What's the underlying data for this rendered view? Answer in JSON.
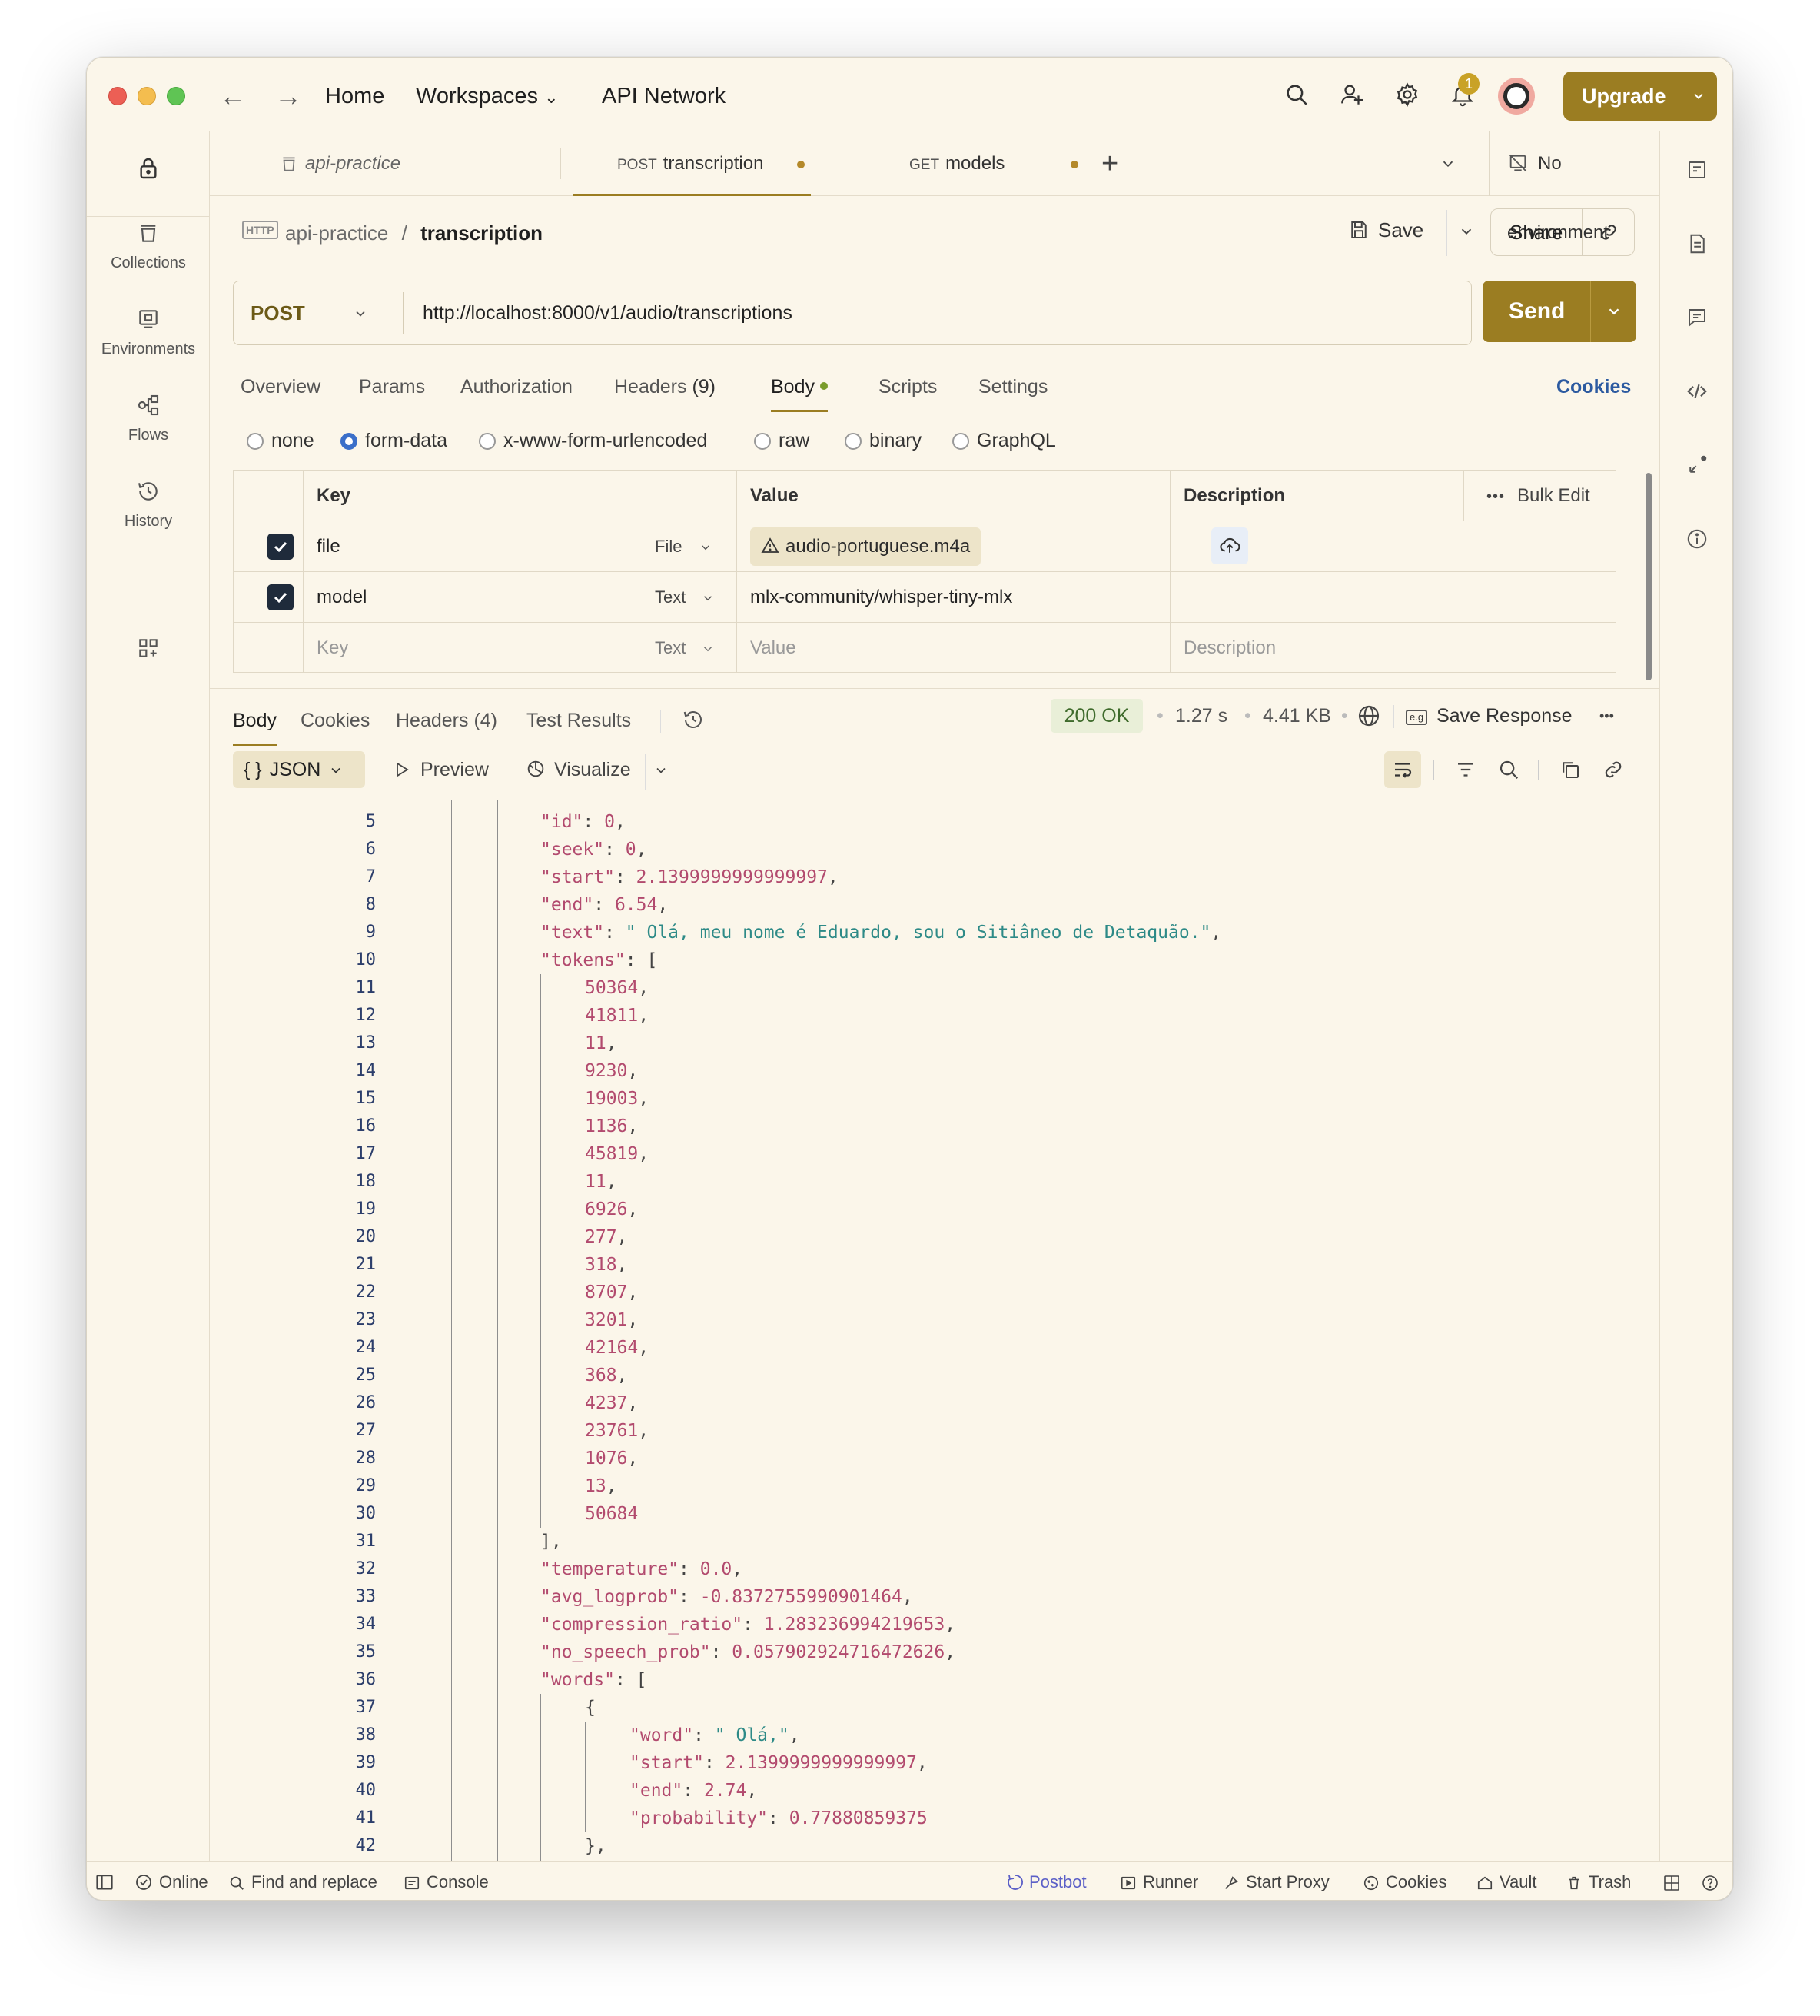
{
  "titlebar": {
    "home": "Home",
    "workspaces": "Workspaces",
    "api_network": "API Network",
    "notification_count": "1",
    "upgrade": "Upgrade"
  },
  "leftbar": {
    "items": [
      {
        "label": "Collections",
        "icon": "collections-icon"
      },
      {
        "label": "Environments",
        "icon": "environments-icon"
      },
      {
        "label": "Flows",
        "icon": "flows-icon"
      },
      {
        "label": "History",
        "icon": "history-icon"
      }
    ]
  },
  "tabs": [
    {
      "method": "",
      "label": "api-practice"
    },
    {
      "method": "POST",
      "label": "transcription"
    },
    {
      "method": "GET",
      "label": "models"
    }
  ],
  "environment": "No environment",
  "breadcrumb": {
    "collection": "api-practice",
    "separator": "/",
    "request": "transcription",
    "http_badge": "HTTP"
  },
  "actions": {
    "save": "Save",
    "share": "Share"
  },
  "request": {
    "method": "POST",
    "url": "http://localhost:8000/v1/audio/transcriptions",
    "send": "Send"
  },
  "request_tabs": [
    "Overview",
    "Params",
    "Authorization",
    "Headers",
    "(9)",
    "Body",
    "Scripts",
    "Settings"
  ],
  "cookies_link": "Cookies",
  "body_types": [
    "none",
    "form-data",
    "x-www-form-urlencoded",
    "raw",
    "binary",
    "GraphQL"
  ],
  "kv_table": {
    "headers": {
      "key": "Key",
      "value": "Value",
      "description": "Description",
      "bulk_edit": "Bulk Edit"
    },
    "rows": [
      {
        "key": "file",
        "type": "File",
        "value": "audio-portuguese.m4a"
      },
      {
        "key": "model",
        "type": "Text",
        "value": "mlx-community/whisper-tiny-mlx"
      }
    ],
    "empty_row": {
      "key": "Key",
      "type": "Text",
      "value": "Value",
      "description": "Description"
    }
  },
  "response": {
    "tabs": [
      "Body",
      "Cookies",
      "Headers (4)",
      "Test Results"
    ],
    "status": "200 OK",
    "time": "1.27 s",
    "size": "4.41 KB",
    "save_response": "Save Response",
    "format": "JSON",
    "preview": "Preview",
    "visualize": "Visualize"
  },
  "code_lines": [
    {
      "n": "5",
      "t": "\"id\": 0,"
    },
    {
      "n": "6",
      "t": "\"seek\": 0,"
    },
    {
      "n": "7",
      "t": "\"start\": 2.1399999999999997,"
    },
    {
      "n": "8",
      "t": "\"end\": 6.54,"
    },
    {
      "n": "9",
      "t": "\"text\": \" Olá, meu nome é Eduardo, sou o Sitiâneo de Detaquão.\","
    },
    {
      "n": "10",
      "t": "\"tokens\": ["
    },
    {
      "n": "11",
      "t": "50364,"
    },
    {
      "n": "12",
      "t": "41811,"
    },
    {
      "n": "13",
      "t": "11,"
    },
    {
      "n": "14",
      "t": "9230,"
    },
    {
      "n": "15",
      "t": "19003,"
    },
    {
      "n": "16",
      "t": "1136,"
    },
    {
      "n": "17",
      "t": "45819,"
    },
    {
      "n": "18",
      "t": "11,"
    },
    {
      "n": "19",
      "t": "6926,"
    },
    {
      "n": "20",
      "t": "277,"
    },
    {
      "n": "21",
      "t": "318,"
    },
    {
      "n": "22",
      "t": "8707,"
    },
    {
      "n": "23",
      "t": "3201,"
    },
    {
      "n": "24",
      "t": "42164,"
    },
    {
      "n": "25",
      "t": "368,"
    },
    {
      "n": "26",
      "t": "4237,"
    },
    {
      "n": "27",
      "t": "23761,"
    },
    {
      "n": "28",
      "t": "1076,"
    },
    {
      "n": "29",
      "t": "13,"
    },
    {
      "n": "30",
      "t": "50684"
    },
    {
      "n": "31",
      "t": "],"
    },
    {
      "n": "32",
      "t": "\"temperature\": 0.0,"
    },
    {
      "n": "33",
      "t": "\"avg_logprob\": -0.8372755990901464,"
    },
    {
      "n": "34",
      "t": "\"compression_ratio\": 1.283236994219653,"
    },
    {
      "n": "35",
      "t": "\"no_speech_prob\": 0.057902924716472626,"
    },
    {
      "n": "36",
      "t": "\"words\": ["
    },
    {
      "n": "37",
      "t": "{"
    },
    {
      "n": "38",
      "t": "\"word\": \" Olá,\","
    },
    {
      "n": "39",
      "t": "\"start\": 2.1399999999999997,"
    },
    {
      "n": "40",
      "t": "\"end\": 2.74,"
    },
    {
      "n": "41",
      "t": "\"probability\": 0.77880859375"
    },
    {
      "n": "42",
      "t": "},"
    }
  ],
  "statusbar": {
    "online": "Online",
    "find_replace": "Find and replace",
    "console": "Console",
    "postbot": "Postbot",
    "runner": "Runner",
    "start_proxy": "Start Proxy",
    "cookies": "Cookies",
    "vault": "Vault",
    "trash": "Trash"
  },
  "colors": {
    "accent": "#9b7d22",
    "background": "#fbf6ea",
    "link": "#2c5aa0",
    "json_key": "#b24a6e",
    "json_string": "#2d8a87"
  }
}
